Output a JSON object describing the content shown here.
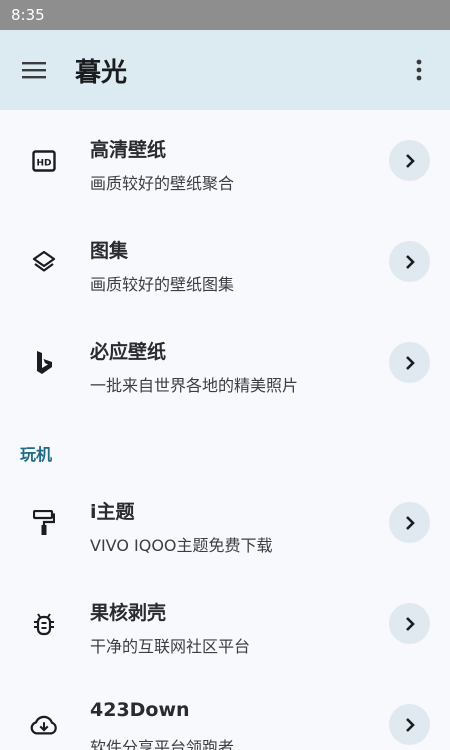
{
  "status_bar": {
    "time": "8:35"
  },
  "app_bar": {
    "menu_icon": "menu-icon",
    "title": "暮光",
    "more_icon": "more-vert-icon"
  },
  "items_top": [
    {
      "icon": "hd-icon",
      "title": "高清壁纸",
      "subtitle": "画质较好的壁纸聚合"
    },
    {
      "icon": "layers-icon",
      "title": "图集",
      "subtitle": "画质较好的壁纸图集"
    },
    {
      "icon": "bing-icon",
      "title": "必应壁纸",
      "subtitle": "一批来自世界各地的精美照片"
    }
  ],
  "section": {
    "title": "玩机"
  },
  "items_bottom": [
    {
      "icon": "paint-roller-icon",
      "title": "i主题",
      "subtitle": "VIVO IQOO主题免费下载"
    },
    {
      "icon": "bug-icon",
      "title": "果核剥壳",
      "subtitle": "干净的互联网社区平台"
    },
    {
      "icon": "cloud-download-icon",
      "title": "423Down",
      "subtitle": "软件分享平台领跑者"
    }
  ],
  "colors": {
    "app_bar_bg": "#dcebf1",
    "page_bg": "#f7f9fd",
    "accent": "#1f6a84",
    "chevron_bg": "#e0e9f0"
  }
}
